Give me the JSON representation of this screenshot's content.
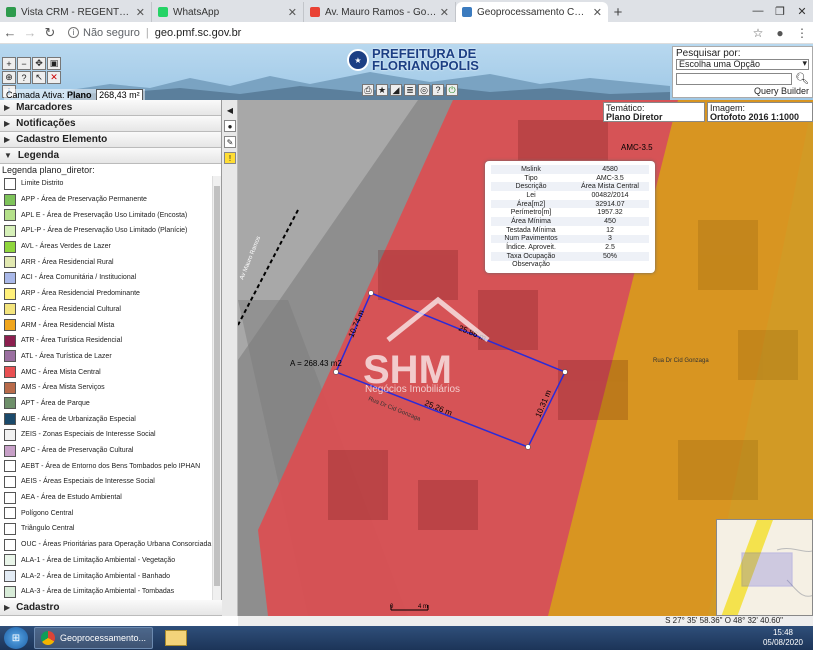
{
  "browser": {
    "tabs": [
      {
        "label": "Vista CRM - REGENTE IMÓVEIS",
        "color": "#2e9b4d",
        "active": false
      },
      {
        "label": "WhatsApp",
        "color": "#25d366",
        "active": false
      },
      {
        "label": "Av. Mauro Ramos - Google Maps",
        "color": "#e94235",
        "active": false
      },
      {
        "label": "Geoprocessamento Corporativo",
        "color": "#3b7bbf",
        "active": true
      }
    ],
    "security_label": "Não seguro",
    "url": "geo.pmf.sc.gov.br"
  },
  "header": {
    "logo_line1": "PREFEITURA DE",
    "logo_line2": "FLORIANÓPOLIS",
    "active_layer_label": "Camada Ativa:",
    "active_layer_value": "Plano",
    "area_value": "268,43 m²"
  },
  "search": {
    "label": "Pesquisar por:",
    "select_value": "Escolha uma Opção",
    "query_builder": "Query Builder"
  },
  "panel": {
    "sections": [
      "Marcadores",
      "Notificações",
      "Cadastro Elemento",
      "Legenda"
    ],
    "legend_title": "Legenda plano_diretor:",
    "legend_items": [
      {
        "label": "Limite Distrito",
        "color": "#ffffff"
      },
      {
        "label": "APP - Área de Preservação Permanente",
        "color": "#7ec35a"
      },
      {
        "label": "APL E - Área de Preservação Uso Limitado (Encosta)",
        "color": "#b4e08a"
      },
      {
        "label": "APL-P - Área de Preservação Uso Limitado (Planície)",
        "color": "#d6f0b8"
      },
      {
        "label": "AVL - Áreas Verdes de Lazer",
        "color": "#8fd63c"
      },
      {
        "label": "ARR - Área Residencial Rural",
        "color": "#e1e8b0"
      },
      {
        "label": "ACI - Área Comunitária / Institucional",
        "color": "#a9b8e8"
      },
      {
        "label": "ARP - Área Residencial Predominante",
        "color": "#fff07a"
      },
      {
        "label": "ARC - Área Residencial Cultural",
        "color": "#f3e47c"
      },
      {
        "label": "ARM - Área Residencial Mista",
        "color": "#f0a51c"
      },
      {
        "label": "ATR - Área Turística Residencial",
        "color": "#8c1f4f"
      },
      {
        "label": "ATL - Área Turística de Lazer",
        "color": "#9a6fa0"
      },
      {
        "label": "AMC - Área Mista Central",
        "color": "#e85052"
      },
      {
        "label": "AMS - Área Mista Serviços",
        "color": "#b86a4a"
      },
      {
        "label": "APT - Área de Parque",
        "color": "#6e8f6a"
      },
      {
        "label": "AUE - Área de Urbanização Especial",
        "color": "#1b4a6b"
      },
      {
        "label": "ZEIS - Zonas Especiais de Interesse Social",
        "color": "#f2f2f2"
      },
      {
        "label": "APC - Área de Preservação Cultural",
        "color": "#c7a0c7"
      },
      {
        "label": "AEBT - Área de Entorno dos Bens Tombados pelo IPHAN",
        "color": "#ffffff"
      },
      {
        "label": "AEIS - Áreas Especiais de Interesse Social",
        "color": "#ffffff"
      },
      {
        "label": "AEA - Área de Estudo Ambiental",
        "color": "#ffffff"
      },
      {
        "label": "Polígono Central",
        "color": "#ffffff"
      },
      {
        "label": "Triângulo Central",
        "color": "#ffffff"
      },
      {
        "label": "OUC - Áreas Prioritárias para Operação Urbana Consorciada",
        "color": "#ffffff"
      },
      {
        "label": "ALA-1 - Área de Limitação Ambiental - Vegetação",
        "color": "#e9f5e9"
      },
      {
        "label": "ALA-2 - Área de Limitação Ambiental - Banhado",
        "color": "#e3ecf5"
      },
      {
        "label": "ALA-3 - Área de Limitação Ambiental - Tombadas",
        "color": "#d8ecd8"
      }
    ],
    "bottom_section": "Cadastro"
  },
  "map": {
    "tematico_label": "Temático:",
    "tematico_value": "Plano Diretor",
    "imagem_label": "Imagem:",
    "imagem_value": "Ortofoto 2016 1:1000",
    "info_rows": [
      {
        "k": "Mslink",
        "v": "4580"
      },
      {
        "k": "Tipo",
        "v": "AMC-3.5"
      },
      {
        "k": "Descrição",
        "v": "Área Mista Central"
      },
      {
        "k": "Lei",
        "v": "00482/2014"
      },
      {
        "k": "Área[m2]",
        "v": "32914.07"
      },
      {
        "k": "Perímetro[m]",
        "v": "1957.32"
      },
      {
        "k": "Área Mínima",
        "v": "450"
      },
      {
        "k": "Testada Mínima",
        "v": "12"
      },
      {
        "k": "Num Pavimentos",
        "v": "3"
      },
      {
        "k": "Índice. Aproveit.",
        "v": "2.5"
      },
      {
        "k": "Taxa Ocupação",
        "v": "50%"
      },
      {
        "k": "Observação",
        "v": ""
      }
    ],
    "area_label": "A = 268.43 m2",
    "dim_top": "25.86 m",
    "dim_left": "10.74 m",
    "dim_bottom": "25.26 m",
    "dim_right": "10.31 m",
    "zone_label": "AMC-3.5",
    "street_label": "Rua Dr Cid Gonzaga",
    "street_label2": "Rua Dr Cid Gonzaga",
    "avenue_label": "Av Mauro Ramos",
    "watermark_main": "SHM",
    "watermark_sub": "Negócios Imobiliários",
    "scale_label": "4 m",
    "scale_zero": "0",
    "coords": "S 27° 35' 58.36\" O 48° 32' 40.60\""
  },
  "taskbar": {
    "task_label": "Geoprocessamento...",
    "time": "15:48",
    "date": "05/08/2020"
  }
}
